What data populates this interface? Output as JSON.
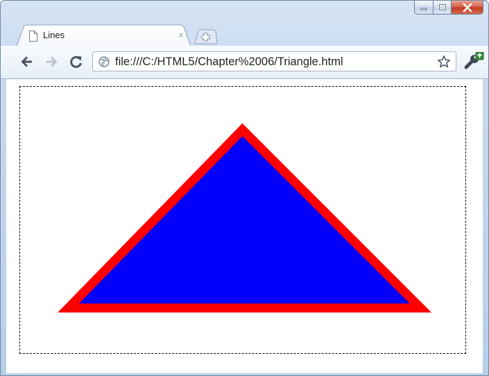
{
  "window": {
    "controls": {
      "minimize_icon": "minimize-icon",
      "maximize_icon": "maximize-icon",
      "close_icon": "close-icon"
    }
  },
  "tab": {
    "title": "Lines",
    "close_glyph": "×",
    "icon": "page-icon"
  },
  "toolbar": {
    "back_icon": "back-arrow-icon",
    "forward_icon": "forward-arrow-icon",
    "reload_icon": "reload-icon",
    "site_icon": "globe-icon",
    "url": "file:///C:/HTML5/Chapter%2006/Triangle.html",
    "bookmark_icon": "star-icon",
    "menu_icon": "wrench-icon"
  },
  "page": {
    "canvas": {
      "border_style": "dashed",
      "border_color": "#000000",
      "shape": "triangle",
      "fill_color": "#0000ff",
      "stroke_color": "#ff0000"
    }
  }
}
